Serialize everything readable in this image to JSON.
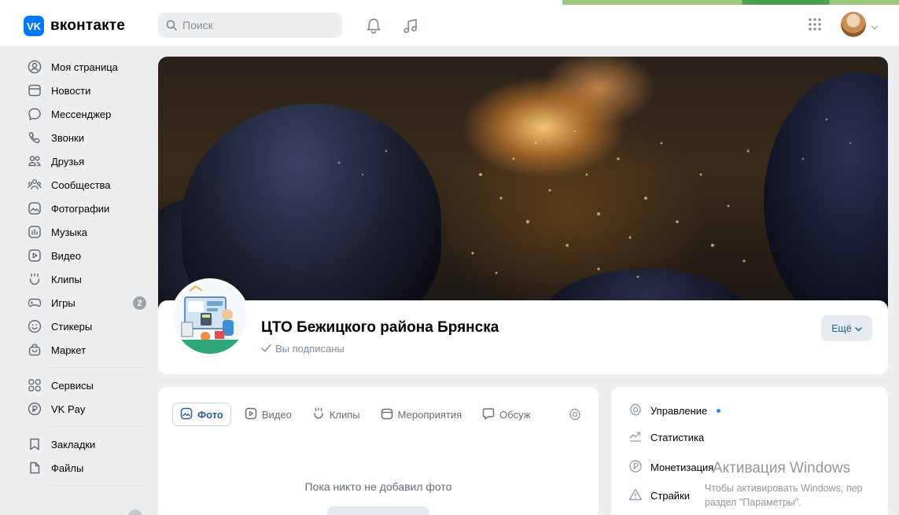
{
  "header": {
    "logo_mark": "VK",
    "logo_text": "вконтакте",
    "search_placeholder": "Поиск",
    "icons": [
      "notifications-bell-icon",
      "music-note-icon",
      "apps-grid-icon",
      "chevron-down-icon"
    ]
  },
  "sidebar": {
    "items": [
      {
        "label": "Моя страница",
        "icon": "user-circle-icon"
      },
      {
        "label": "Новости",
        "icon": "news-icon"
      },
      {
        "label": "Мессенджер",
        "icon": "message-icon"
      },
      {
        "label": "Звонки",
        "icon": "phone-icon"
      },
      {
        "label": "Друзья",
        "icon": "friends-icon"
      },
      {
        "label": "Сообщества",
        "icon": "communities-icon"
      },
      {
        "label": "Фотографии",
        "icon": "photo-icon"
      },
      {
        "label": "Музыка",
        "icon": "music-icon"
      },
      {
        "label": "Видео",
        "icon": "video-icon"
      },
      {
        "label": "Клипы",
        "icon": "clips-icon"
      },
      {
        "label": "Игры",
        "icon": "gamepad-icon",
        "badge": "2"
      },
      {
        "label": "Стикеры",
        "icon": "sticker-icon"
      },
      {
        "label": "Маркет",
        "icon": "market-bag-icon"
      }
    ],
    "secondary": [
      {
        "label": "Сервисы",
        "icon": "services-icon"
      },
      {
        "label": "VK Pay",
        "icon": "vkpay-icon"
      }
    ],
    "tertiary": [
      {
        "label": "Закладки",
        "icon": "bookmark-icon"
      },
      {
        "label": "Файлы",
        "icon": "file-icon"
      }
    ]
  },
  "group": {
    "name": "ЦТО Бежицкого района Брянска",
    "status": "Вы подписаны",
    "more_button": "Ещё"
  },
  "media": {
    "tabs": [
      "Фото",
      "Видео",
      "Клипы",
      "Мероприятия",
      "Обсуж"
    ],
    "active_tab": "Фото",
    "empty_text": "Пока никто не добавил фото"
  },
  "manage": {
    "items": [
      "Управление",
      "Статистика",
      "Монетизация",
      "Страйки"
    ]
  },
  "watermark": {
    "title": "Активация Windows",
    "line1": "Чтобы активировать Windows, пер",
    "line2": "раздел \"Параметры\"."
  },
  "colors": {
    "accent": "#0077ff",
    "link": "#2c5d96",
    "muted": "#818c99",
    "background": "#edeef0"
  }
}
